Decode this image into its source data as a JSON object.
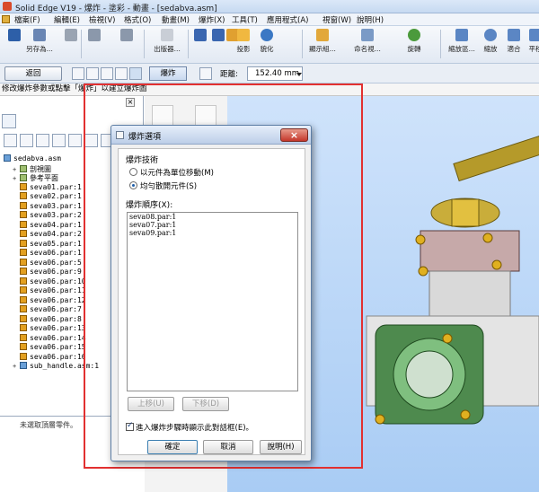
{
  "window": {
    "title": "Solid Edge V19 - 爆炸 - 塗彩 - 動畫 - [sedabva.asm]"
  },
  "menu": [
    "檔案(F)",
    "編輯(E)",
    "檢視(V)",
    "格式(O)",
    "動畫(M)",
    "爆炸(X)",
    "工具(T)",
    "應用程式(A)",
    "視窗(W)",
    "說明(H)"
  ],
  "toolbar": {
    "save_as": "另存為...",
    "publish": "出版器...",
    "project": "投影",
    "render": "貌化",
    "display_group": "顯示組...",
    "name_view": "命名視...",
    "rotate": "旋轉",
    "zoom_area": "縮放區...",
    "zoom": "縮放",
    "fit": "適合",
    "pan": "平移"
  },
  "command_bar": {
    "return_label": "返回",
    "explode_label": "爆炸",
    "distance_label": "距離:",
    "distance_value": "152.40 mm"
  },
  "prompt": "修改爆炸參數或點擊「爆炸」以建立爆炸圖",
  "tree": {
    "root": "sedabva.asm",
    "children": [
      {
        "label": "剖視圖",
        "type": "folder",
        "expander": "+"
      },
      {
        "label": "參考平面",
        "type": "folder",
        "expander": "+"
      },
      {
        "label": "seva01.par:1",
        "type": "part"
      },
      {
        "label": "seva02.par:1",
        "type": "part"
      },
      {
        "label": "seva03.par:1",
        "type": "part"
      },
      {
        "label": "seva03.par:2",
        "type": "part"
      },
      {
        "label": "seva04.par:1",
        "type": "part"
      },
      {
        "label": "seva04.par:2",
        "type": "part"
      },
      {
        "label": "seva05.par:1",
        "type": "part"
      },
      {
        "label": "seva06.par:1",
        "type": "part"
      },
      {
        "label": "seva06.par:5",
        "type": "part"
      },
      {
        "label": "seva06.par:9",
        "type": "part"
      },
      {
        "label": "seva06.par:10",
        "type": "part"
      },
      {
        "label": "seva06.par:11",
        "type": "part"
      },
      {
        "label": "seva06.par:12",
        "type": "part"
      },
      {
        "label": "seva06.par:7",
        "type": "part"
      },
      {
        "label": "seva06.par:8",
        "type": "part"
      },
      {
        "label": "seva06.par:13",
        "type": "part"
      },
      {
        "label": "seva06.par:14",
        "type": "part"
      },
      {
        "label": "seva06.par:15",
        "type": "part"
      },
      {
        "label": "seva06.par:16",
        "type": "part"
      },
      {
        "label": "sub_handle.asm:1",
        "type": "assembly",
        "expander": "+"
      }
    ]
  },
  "status_left": "未選取頂層零件。",
  "dialog": {
    "title": "爆炸選項",
    "technique_label": "爆炸技術",
    "option_unit": "以元件為單位移動(M)",
    "option_uniform": "均勻散開元件(S)",
    "selected_option": "uniform",
    "sequence_label": "爆炸順序(X):",
    "sequence": [
      "seva08.par:1",
      "seva07.par:1",
      "seva09.par:1"
    ],
    "move_up": "上移(U)",
    "move_down": "下移(D)",
    "checkbox_label": "進入爆炸步驟時顯示此對話框(E)。",
    "checkbox_checked": true,
    "ok": "確定",
    "cancel": "取消",
    "help": "說明(H)"
  },
  "colors": {
    "highlight_frame": "#e23030",
    "viewport_bg": "#b9d6f8",
    "dialog_close": "#c4362a"
  }
}
